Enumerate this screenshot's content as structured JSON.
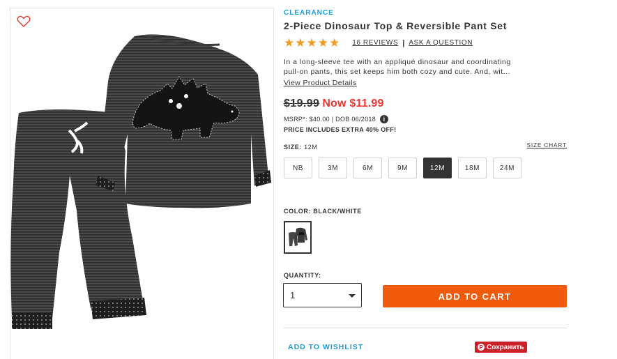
{
  "product": {
    "badge": "CLEARANCE",
    "title": "2-Piece Dinosaur Top & Reversible Pant Set",
    "rating_stars": "★★★★★",
    "reviews_link": "16 REVIEWS",
    "separator": "|",
    "ask_question": "ASK A QUESTION",
    "description_line1": "In a long-sleeve tee with an appliqué dinosaur and coordinating",
    "description_line2": "pull-on pants, this set keeps him both cozy and cute. And, wit...",
    "view_details": "View Product Details"
  },
  "pricing": {
    "old_price": "$19.99",
    "now_price": "Now $11.99",
    "msrp_text": "MSRP*: $40.00 | DOB 06/2018",
    "info_icon": "i",
    "extra_note": "PRICE INCLUDES EXTRA 40% OFF!"
  },
  "size": {
    "label": "SIZE:",
    "selected": "12M",
    "chart_link": "SIZE CHART",
    "options": [
      "NB",
      "3M",
      "6M",
      "9M",
      "12M",
      "18M",
      "24M"
    ]
  },
  "color": {
    "label": "COLOR:",
    "selected": "BLACK/WHITE"
  },
  "quantity": {
    "label": "QUANTITY:",
    "value": "1"
  },
  "actions": {
    "add_to_cart": "ADD TO CART",
    "add_to_wishlist": "ADD TO WISHLIST",
    "pin_logo": "P",
    "pin_save": "Сохранить"
  },
  "colors": {
    "accent_blue": "#1d9ad6",
    "sale_red": "#e8372f",
    "cart_orange": "#f05a0b",
    "star_gold": "#ef9b1f",
    "pinterest_red": "#cb2027"
  }
}
